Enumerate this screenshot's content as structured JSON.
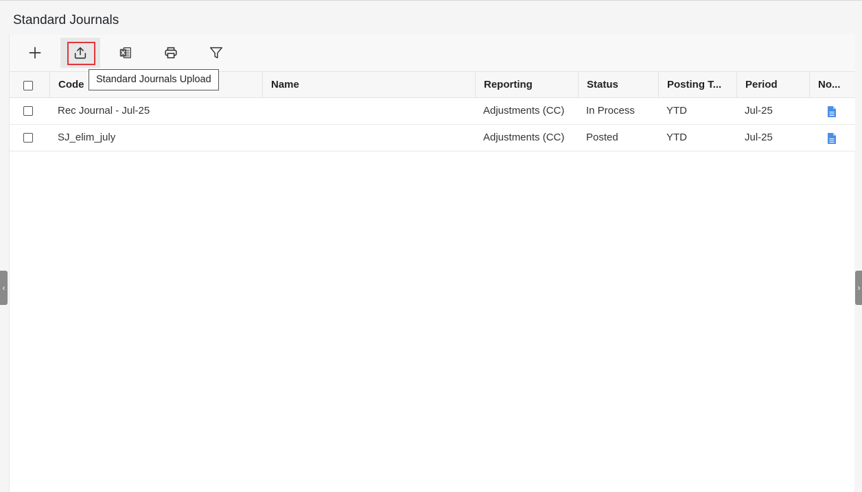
{
  "page": {
    "title": "Standard Journals"
  },
  "toolbar": {
    "tooltip": "Standard Journals Upload",
    "icons": [
      "plus-icon",
      "upload-icon",
      "excel-icon",
      "printer-icon",
      "filter-icon"
    ]
  },
  "table": {
    "headers": {
      "code": "Code",
      "name": "Name",
      "reporting": "Reporting",
      "status": "Status",
      "posting": "Posting T...",
      "period": "Period",
      "notes": "No..."
    },
    "rows": [
      {
        "code": "Rec Journal - Jul-25",
        "name": "",
        "reporting": "Adjustments (CC)",
        "status": "In Process",
        "posting": "YTD",
        "period": "Jul-25"
      },
      {
        "code": "SJ_elim_july",
        "name": "",
        "reporting": "Adjustments (CC)",
        "status": "Posted",
        "posting": "YTD",
        "period": "Jul-25"
      }
    ]
  },
  "colors": {
    "highlight": "#e0353b",
    "doc_icon": "#4a8fe7"
  }
}
